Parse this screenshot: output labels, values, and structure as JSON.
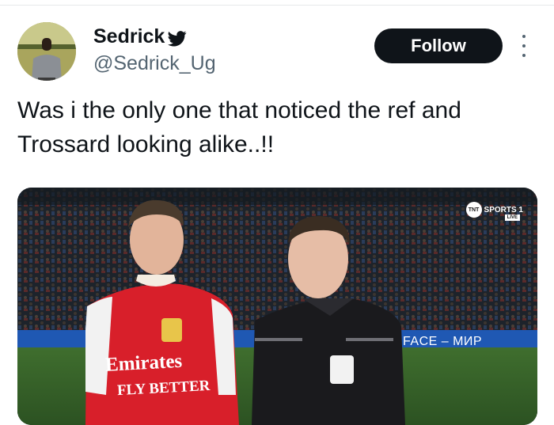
{
  "header": {
    "display_name": "Sedrick",
    "handle": "@Sedrick_Ug",
    "follow_label": "Follow"
  },
  "tweet": {
    "text": "Was i the only one that noticed the ref and Trossard looking alike..!!"
  },
  "media": {
    "broadcaster_logo": "TNT",
    "broadcaster_name": "SPORTS 1",
    "live_tag": "LIVE",
    "ad_board_text": "FACE – МИР",
    "shirt_sponsor": "Emirates",
    "shirt_slogan": "FLY BETTER"
  },
  "colors": {
    "follow_bg": "#0f1419",
    "text_primary": "#0f1419",
    "text_secondary": "#536471",
    "arsenal_red": "#d81f2a",
    "referee_black": "#1a1a1d"
  },
  "icons": [
    "twitter-bird-icon",
    "more-options-icon"
  ]
}
